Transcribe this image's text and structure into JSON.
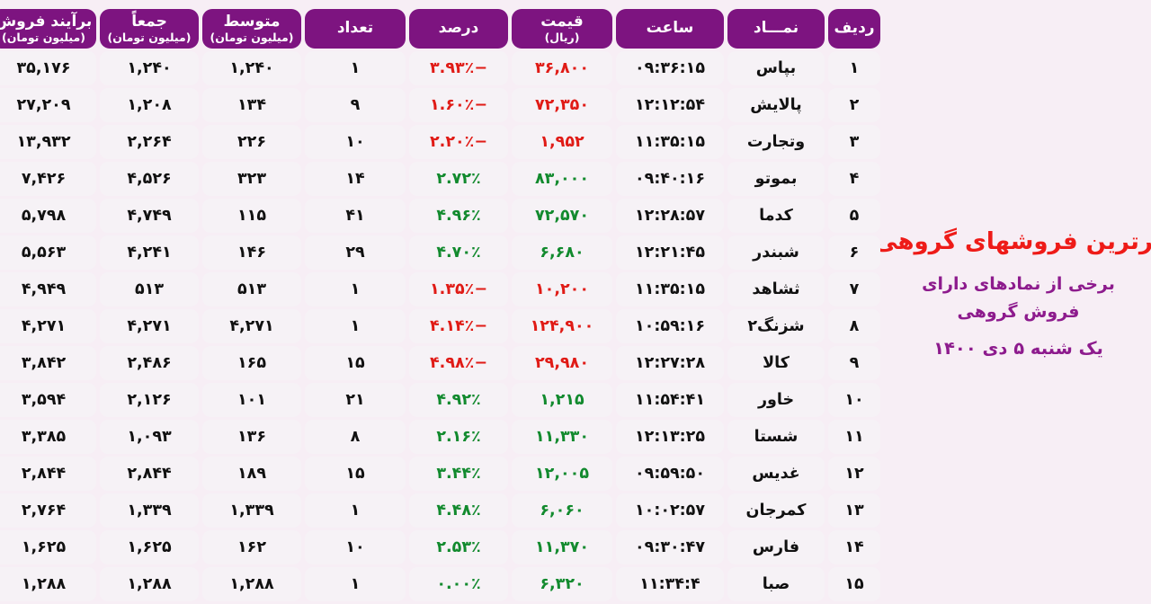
{
  "header": {
    "columns": [
      {
        "key": "radif",
        "label": "ردیف",
        "sub": ""
      },
      {
        "key": "namad",
        "label": "نمـــاد",
        "sub": ""
      },
      {
        "key": "saat",
        "label": "ساعت",
        "sub": ""
      },
      {
        "key": "gheymat",
        "label": "قیمت",
        "sub": "(ریال)"
      },
      {
        "key": "darsad",
        "label": "درصد",
        "sub": ""
      },
      {
        "key": "tedad",
        "label": "تعداد",
        "sub": ""
      },
      {
        "key": "motavaset",
        "label": "متوسط",
        "sub": "(میلیون تومان)"
      },
      {
        "key": "jaman",
        "label": "جمعاً",
        "sub": "(میلیون تومان)"
      },
      {
        "key": "baraand",
        "label": "برآیند فروش",
        "sub": "(میلیون تومان)"
      }
    ]
  },
  "title_panel": {
    "main_title": "برترین فروشهای گروهی",
    "sub_line_1": "برخی از نمادهای دارای",
    "sub_line_2": "فروش گروهی",
    "date": "یک شنبه ۵ دی ۱۴۰۰"
  },
  "colors": {
    "header_purple": "#7d1480",
    "page_background": "#f7eef5",
    "cell_background": "#f6f2f6",
    "up_green": "#128a2e",
    "down_red": "#e01b16",
    "title_red": "#ee1b18",
    "title_purple": "#8d1b8d"
  },
  "rows": [
    {
      "radif": "۱",
      "namad": "بپاس",
      "saat": "۰۹:۳۶:۱۵",
      "gheymat": "۳۶,۸۰۰",
      "gheymat_dir": "down",
      "darsad": "−۳.۹۳٪",
      "darsad_dir": "down",
      "tedad": "۱",
      "motavaset": "۱,۲۴۰",
      "jaman": "۱,۲۴۰",
      "baraand": "۳۵,۱۷۶"
    },
    {
      "radif": "۲",
      "namad": "پالایش",
      "saat": "۱۲:۱۲:۵۴",
      "gheymat": "۷۲,۳۵۰",
      "gheymat_dir": "down",
      "darsad": "−۱.۶۰٪",
      "darsad_dir": "down",
      "tedad": "۹",
      "motavaset": "۱۳۴",
      "jaman": "۱,۲۰۸",
      "baraand": "۲۷,۲۰۹"
    },
    {
      "radif": "۳",
      "namad": "وتجارت",
      "saat": "۱۱:۳۵:۱۵",
      "gheymat": "۱,۹۵۲",
      "gheymat_dir": "down",
      "darsad": "−۲.۲۰٪",
      "darsad_dir": "down",
      "tedad": "۱۰",
      "motavaset": "۲۲۶",
      "jaman": "۲,۲۶۴",
      "baraand": "۱۳,۹۳۲"
    },
    {
      "radif": "۴",
      "namad": "بموتو",
      "saat": "۰۹:۴۰:۱۶",
      "gheymat": "۸۳,۰۰۰",
      "gheymat_dir": "up",
      "darsad": "۲.۷۲٪",
      "darsad_dir": "up",
      "tedad": "۱۴",
      "motavaset": "۳۲۳",
      "jaman": "۴,۵۲۶",
      "baraand": "۷,۴۲۶"
    },
    {
      "radif": "۵",
      "namad": "کدما",
      "saat": "۱۲:۲۸:۵۷",
      "gheymat": "۷۲,۵۷۰",
      "gheymat_dir": "up",
      "darsad": "۴.۹۶٪",
      "darsad_dir": "up",
      "tedad": "۴۱",
      "motavaset": "۱۱۵",
      "jaman": "۴,۷۴۹",
      "baraand": "۵,۷۹۸"
    },
    {
      "radif": "۶",
      "namad": "شبندر",
      "saat": "۱۲:۲۱:۴۵",
      "gheymat": "۶,۶۸۰",
      "gheymat_dir": "up",
      "darsad": "۴.۷۰٪",
      "darsad_dir": "up",
      "tedad": "۲۹",
      "motavaset": "۱۴۶",
      "jaman": "۴,۲۴۱",
      "baraand": "۵,۵۶۳"
    },
    {
      "radif": "۷",
      "namad": "ثشاهد",
      "saat": "۱۱:۳۵:۱۵",
      "gheymat": "۱۰,۲۰۰",
      "gheymat_dir": "down",
      "darsad": "−۱.۳۵٪",
      "darsad_dir": "down",
      "tedad": "۱",
      "motavaset": "۵۱۳",
      "jaman": "۵۱۳",
      "baraand": "۴,۹۴۹"
    },
    {
      "radif": "۸",
      "namad": "شزنگ۲",
      "saat": "۱۰:۵۹:۱۶",
      "gheymat": "۱۲۴,۹۰۰",
      "gheymat_dir": "down",
      "darsad": "−۴.۱۴٪",
      "darsad_dir": "down",
      "tedad": "۱",
      "motavaset": "۴,۲۷۱",
      "jaman": "۴,۲۷۱",
      "baraand": "۴,۲۷۱"
    },
    {
      "radif": "۹",
      "namad": "کالا",
      "saat": "۱۲:۲۷:۲۸",
      "gheymat": "۲۹,۹۸۰",
      "gheymat_dir": "down",
      "darsad": "−۴.۹۸٪",
      "darsad_dir": "down",
      "tedad": "۱۵",
      "motavaset": "۱۶۵",
      "jaman": "۲,۴۸۶",
      "baraand": "۳,۸۴۲"
    },
    {
      "radif": "۱۰",
      "namad": "خاور",
      "saat": "۱۱:۵۴:۴۱",
      "gheymat": "۱,۲۱۵",
      "gheymat_dir": "up",
      "darsad": "۴.۹۲٪",
      "darsad_dir": "up",
      "tedad": "۲۱",
      "motavaset": "۱۰۱",
      "jaman": "۲,۱۲۶",
      "baraand": "۳,۵۹۴"
    },
    {
      "radif": "۱۱",
      "namad": "شستا",
      "saat": "۱۲:۱۳:۲۵",
      "gheymat": "۱۱,۳۳۰",
      "gheymat_dir": "up",
      "darsad": "۲.۱۶٪",
      "darsad_dir": "up",
      "tedad": "۸",
      "motavaset": "۱۳۶",
      "jaman": "۱,۰۹۳",
      "baraand": "۳,۳۸۵"
    },
    {
      "radif": "۱۲",
      "namad": "غدیس",
      "saat": "۰۹:۵۹:۵۰",
      "gheymat": "۱۲,۰۰۵",
      "gheymat_dir": "up",
      "darsad": "۳.۴۴٪",
      "darsad_dir": "up",
      "tedad": "۱۵",
      "motavaset": "۱۸۹",
      "jaman": "۲,۸۴۴",
      "baraand": "۲,۸۴۴"
    },
    {
      "radif": "۱۳",
      "namad": "کمرجان",
      "saat": "۱۰:۰۲:۵۷",
      "gheymat": "۶,۰۶۰",
      "gheymat_dir": "up",
      "darsad": "۴.۴۸٪",
      "darsad_dir": "up",
      "tedad": "۱",
      "motavaset": "۱,۳۳۹",
      "jaman": "۱,۳۳۹",
      "baraand": "۲,۷۶۴"
    },
    {
      "radif": "۱۴",
      "namad": "فارس",
      "saat": "۰۹:۳۰:۴۷",
      "gheymat": "۱۱,۳۷۰",
      "gheymat_dir": "up",
      "darsad": "۲.۵۳٪",
      "darsad_dir": "up",
      "tedad": "۱۰",
      "motavaset": "۱۶۲",
      "jaman": "۱,۶۲۵",
      "baraand": "۱,۶۲۵"
    },
    {
      "radif": "۱۵",
      "namad": "صبا",
      "saat": "۱۱:۳۴:۴",
      "gheymat": "۶,۳۲۰",
      "gheymat_dir": "up",
      "darsad": "۰.۰۰٪",
      "darsad_dir": "neutral",
      "tedad": "۱",
      "motavaset": "۱,۲۸۸",
      "jaman": "۱,۲۸۸",
      "baraand": "۱,۲۸۸"
    }
  ]
}
